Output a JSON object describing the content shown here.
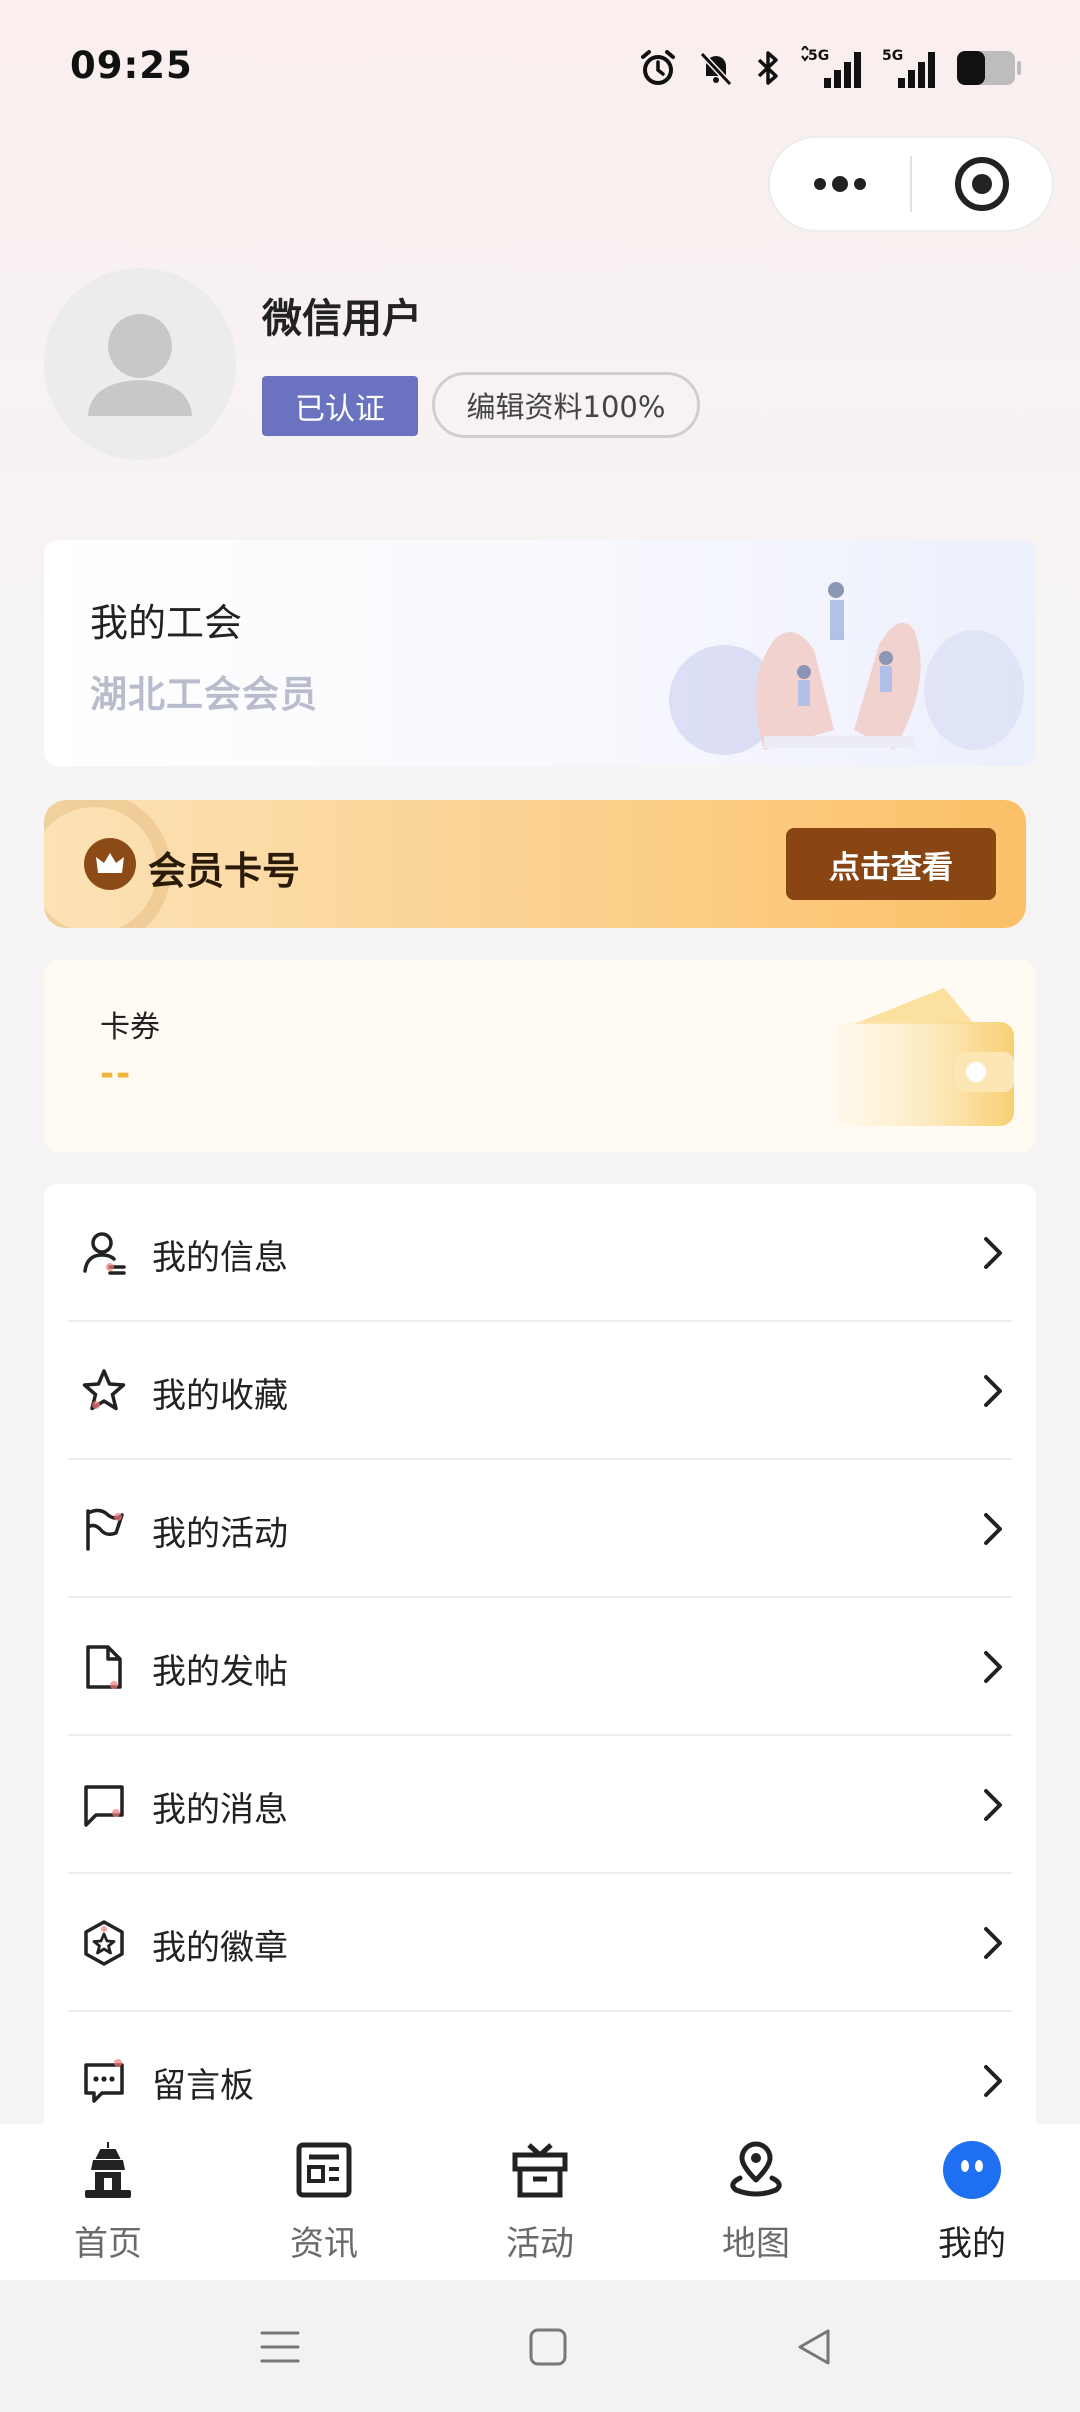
{
  "status_bar": {
    "time": "09:25",
    "battery": "45"
  },
  "profile": {
    "name": "微信用户",
    "verified_label": "已认证",
    "edit_label": "编辑资料100%"
  },
  "union_card": {
    "title": "我的工会",
    "subtitle": "湖北工会会员"
  },
  "member_card": {
    "title": "会员卡号",
    "button_label": "点击查看"
  },
  "coupon_card": {
    "title": "卡券",
    "value": "--"
  },
  "menu": {
    "items": [
      {
        "label": "我的信息",
        "icon": "user-info-icon"
      },
      {
        "label": "我的收藏",
        "icon": "star-icon"
      },
      {
        "label": "我的活动",
        "icon": "flag-icon"
      },
      {
        "label": "我的发帖",
        "icon": "document-icon"
      },
      {
        "label": "我的消息",
        "icon": "message-icon"
      },
      {
        "label": "我的徽章",
        "icon": "badge-icon"
      },
      {
        "label": "留言板",
        "icon": "comment-board-icon"
      }
    ]
  },
  "tab_bar": {
    "tabs": [
      {
        "label": "首页",
        "icon": "home-tower-icon"
      },
      {
        "label": "资讯",
        "icon": "news-icon"
      },
      {
        "label": "活动",
        "icon": "gift-icon"
      },
      {
        "label": "地图",
        "icon": "map-pin-icon"
      },
      {
        "label": "我的",
        "icon": "mine-face-icon",
        "active": true
      }
    ]
  },
  "colors": {
    "verified_bg": "#6b73c0",
    "member_button": "#8a4514",
    "coupon_value": "#f2b33a",
    "active_tab": "#1f6ff2"
  }
}
